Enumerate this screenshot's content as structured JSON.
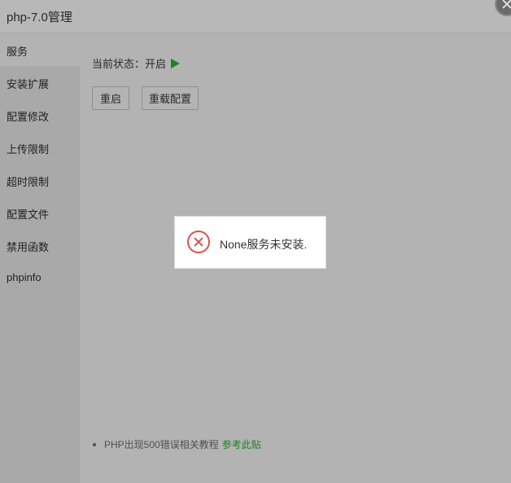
{
  "window": {
    "title": "php-7.0管理"
  },
  "sidebar": {
    "items": [
      {
        "label": "服务",
        "active": true
      },
      {
        "label": "安装扩展",
        "active": false
      },
      {
        "label": "配置修改",
        "active": false
      },
      {
        "label": "上传限制",
        "active": false
      },
      {
        "label": "超时限制",
        "active": false
      },
      {
        "label": "配置文件",
        "active": false
      },
      {
        "label": "禁用函数",
        "active": false
      },
      {
        "label": "phpinfo",
        "active": false
      }
    ]
  },
  "main": {
    "status_label": "当前状态：",
    "status_value": "开启",
    "buttons": {
      "restart": "重启",
      "reload": "重载配置"
    },
    "help": {
      "text": "PHP出现500错误相关教程",
      "link": "参考此贴"
    }
  },
  "toast": {
    "message": "None服务未安装."
  },
  "colors": {
    "accent_green": "#17841f",
    "error_red": "#d9534f"
  }
}
